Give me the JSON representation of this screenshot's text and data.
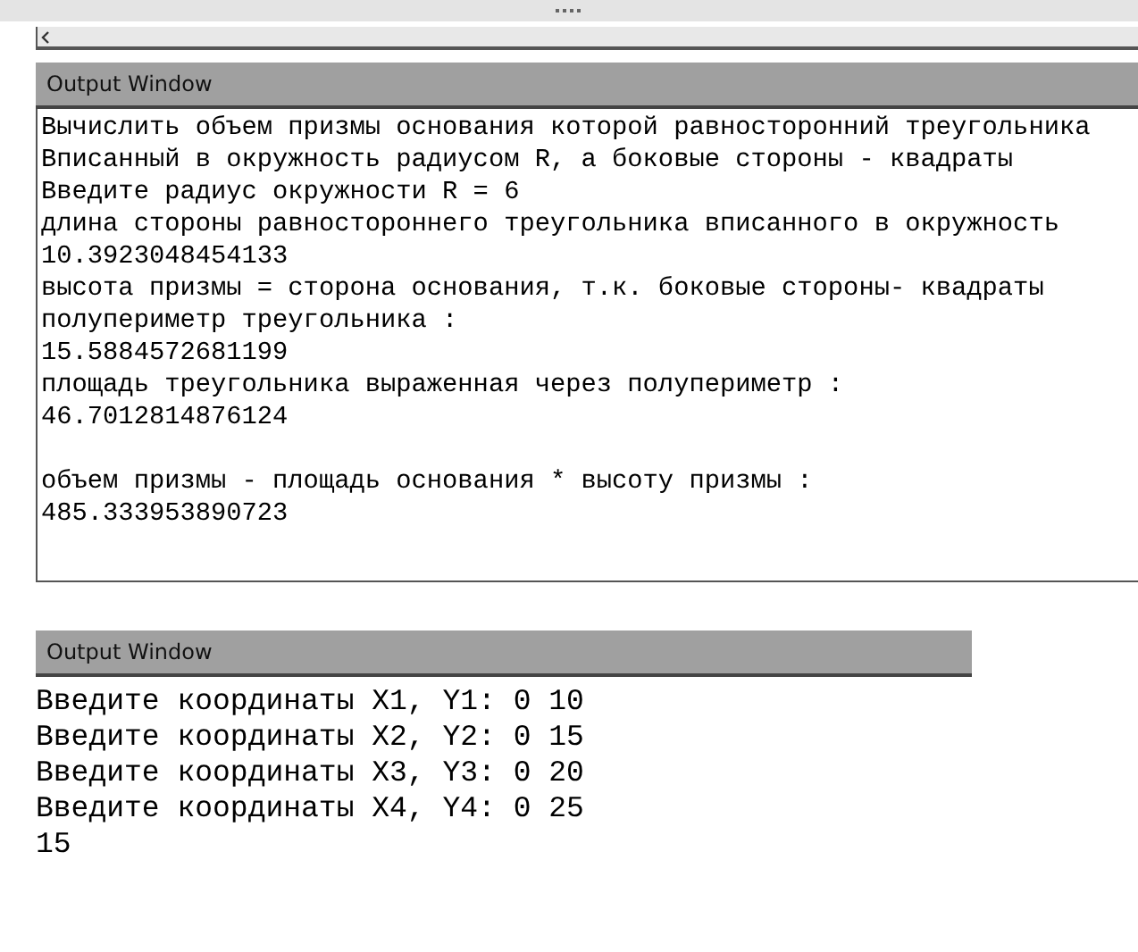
{
  "output_windows": [
    {
      "title": "Output Window",
      "kind": "bordered",
      "blocks": [
        [
          "Вычислить объем призмы основания которой равносторонний треугольника",
          "Вписанный в окружность радиусом R, а боковые стороны - квадраты",
          "Введите радиус окружности R = 6",
          "длина стороны равностороннего треугольника вписанного в окружность",
          "10.3923048454133",
          "высота призмы = сторона основания, т.к. боковые стороны- квадраты",
          "полупериметр треугольника :",
          "15.5884572681199",
          "площадь треугольника выраженная через полупериметр :",
          "46.7012814876124"
        ],
        [
          "объем призмы - площадь основания * высоту призмы :",
          "485.333953890723"
        ]
      ]
    },
    {
      "title": "Output Window",
      "kind": "plain",
      "blocks": [
        [
          "Введите координаты X1, Y1: 0 10",
          "Введите координаты X2, Y2: 0 15",
          "Введите координаты X3, Y3: 0 20",
          "Введите координаты X4, Y4: 0 25",
          "15"
        ]
      ]
    }
  ]
}
